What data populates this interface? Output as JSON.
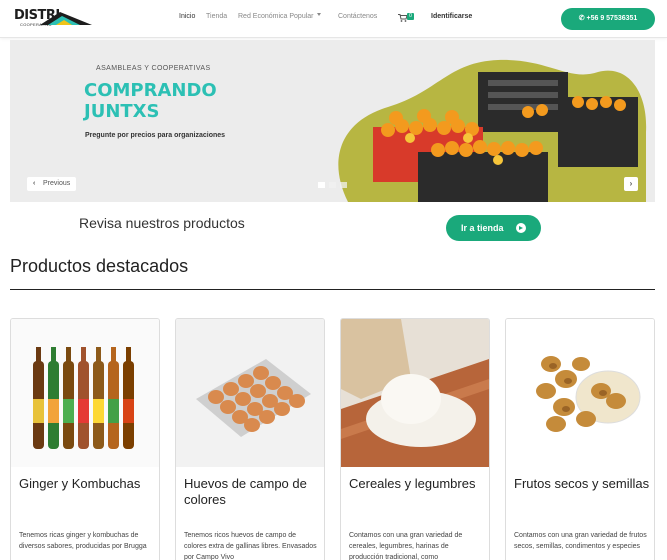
{
  "brand": {
    "logo_text": "DISTRI",
    "logo_sub": "COOPERATIVA"
  },
  "nav": {
    "links": [
      "Inicio",
      "Tienda",
      "Red Económica Popular",
      "Contáctenos"
    ],
    "cart_count": "0",
    "identify": "Identificarse",
    "phone": "+56 9 57536351",
    "icons": [
      "cart-icon",
      "whatsapp-icon"
    ]
  },
  "carousel": {
    "kicker": "ASAMBLEAS Y COOPERATIVAS",
    "title_line1": "COMPRANDO",
    "title_line2": "JUNTXS",
    "subtitle": "Pregunte por precios para organizaciones",
    "prev_label": "Previous",
    "slides": 3,
    "active_slide": 1,
    "colors": {
      "accent": "#2cc0b4",
      "blob": "#b7b642",
      "crate": "#d83a2a"
    }
  },
  "cta": {
    "text": "Revisa nuestros productos",
    "button": "Ir a tienda"
  },
  "featured": {
    "title": "Productos destacados",
    "products": [
      {
        "title": "Ginger y Kombuchas",
        "desc": "Tenemos ricas ginger y kombuchas de diversos sabores, producidas por Brugga"
      },
      {
        "title": "Huevos de campo de colores",
        "desc": "Tenemos ricos huevos de campo de colores extra de gallinas libres. Envasados por Campo Vivo"
      },
      {
        "title": "Cereales y legumbres",
        "desc": "Contamos con una gran variedad de cereales, legumbres, harinas de producción tradicional, como"
      },
      {
        "title": "Frutos secos y semillas",
        "desc": "Contamos con una gran variedad de frutos secos, semillas, condimentos y especies"
      }
    ]
  },
  "colors": {
    "primary": "#1aa97b",
    "text": "#333333"
  }
}
